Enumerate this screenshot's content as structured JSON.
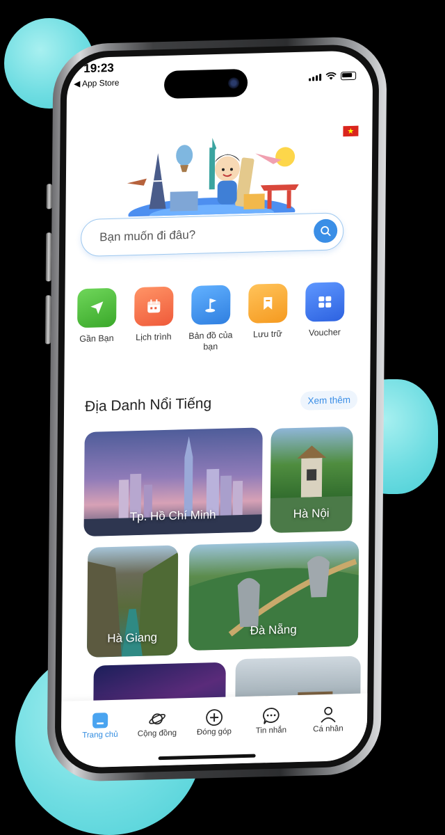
{
  "status_bar": {
    "time": "19:23",
    "back_label": "◀ App Store"
  },
  "search": {
    "placeholder": "Bạn muốn đi đâu?"
  },
  "categories": [
    {
      "label": "Gần Bạn",
      "color": "#4bbf3a",
      "icon": "navigation-arrow-icon"
    },
    {
      "label": "Lịch trình",
      "color": "#f26d45",
      "icon": "calendar-icon"
    },
    {
      "label": "Bản đồ của bạn",
      "color": "#3b8fe8",
      "icon": "map-flag-icon"
    },
    {
      "label": "Lưu trữ",
      "color": "#f7a531",
      "icon": "bookmark-icon"
    },
    {
      "label": "Voucher",
      "color": "#3a74e6",
      "icon": "voucher-icon"
    }
  ],
  "section": {
    "title": "Địa Danh Nổi Tiếng",
    "see_more": "Xem thêm"
  },
  "places": [
    {
      "name": "Tp. Hồ Chí Minh"
    },
    {
      "name": "Hà Nội"
    },
    {
      "name": "Hà Giang"
    },
    {
      "name": "Đà Nẵng"
    }
  ],
  "bottom_nav": [
    {
      "label": "Trang chủ",
      "icon": "home-icon",
      "active": true
    },
    {
      "label": "Cộng đồng",
      "icon": "planet-icon",
      "active": false
    },
    {
      "label": "Đóng góp",
      "icon": "plus-circle-icon",
      "active": false
    },
    {
      "label": "Tin nhắn",
      "icon": "chat-icon",
      "active": false
    },
    {
      "label": "Cá nhân",
      "icon": "user-icon",
      "active": false
    }
  ],
  "colors": {
    "accent": "#3a8ee6",
    "background_blob": "#6fdde2"
  }
}
